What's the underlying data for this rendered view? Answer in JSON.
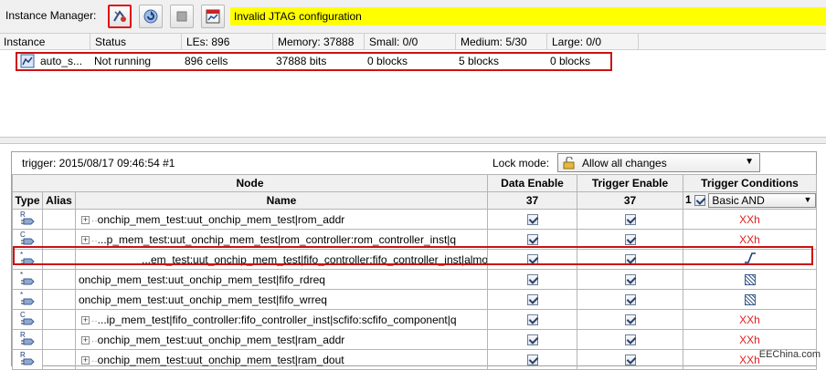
{
  "toolbar": {
    "label": "Instance Manager:",
    "status_message": "Invalid JTAG configuration",
    "status_bg": "#ffff00",
    "buttons": [
      {
        "name": "autorun-analysis-icon"
      },
      {
        "name": "run-analysis-icon"
      },
      {
        "name": "stop-analysis-icon"
      },
      {
        "name": "read-data-icon"
      }
    ]
  },
  "instance_table": {
    "headers": {
      "instance": "Instance",
      "status": "Status",
      "les": "LEs: 896",
      "memory": "Memory: 37888",
      "small": "Small: 0/0",
      "medium": "Medium: 5/30",
      "large": "Large: 0/0"
    },
    "row": {
      "instance": "auto_s...",
      "status": "Not running",
      "les": "896 cells",
      "memory": "37888 bits",
      "small": "0 blocks",
      "medium": "5 blocks",
      "large": "0 blocks"
    }
  },
  "trigger_panel": {
    "trigger_info": "trigger: 2015/08/17 09:46:54  #1",
    "lock_mode_label": "Lock mode:",
    "lock_mode_value": "Allow all changes",
    "headers": {
      "node": "Node",
      "data_enable": "Data Enable",
      "trigger_enable": "Trigger Enable",
      "trigger_conditions": "Trigger Conditions",
      "type": "Type",
      "alias": "Alias",
      "name": "Name",
      "data_enable_count": "37",
      "trigger_enable_count": "37",
      "trigger_cond_index": "1",
      "trigger_cond_mode": "Basic AND"
    },
    "rows": [
      {
        "type_letter": "R",
        "expandable": true,
        "name": "onchip_mem_test:uut_onchip_mem_test|rom_addr",
        "condition": "XXh"
      },
      {
        "type_letter": "C",
        "expandable": true,
        "name": "...p_mem_test:uut_onchip_mem_test|rom_controller:rom_controller_inst|q",
        "condition": "XXh"
      },
      {
        "type_letter": "*",
        "expandable": false,
        "name": "...em_test:uut_onchip_mem_test|fifo_controller:fifo_controller_inst|almost_full",
        "condition": "rising-edge"
      },
      {
        "type_letter": "*",
        "expandable": false,
        "name": "onchip_mem_test:uut_onchip_mem_test|fifo_rdreq",
        "condition": "either-edge"
      },
      {
        "type_letter": "*",
        "expandable": false,
        "name": "onchip_mem_test:uut_onchip_mem_test|fifo_wrreq",
        "condition": "either-edge"
      },
      {
        "type_letter": "C",
        "expandable": true,
        "name": "...ip_mem_test|fifo_controller:fifo_controller_inst|scfifo:scfifo_component|q",
        "condition": "XXh"
      },
      {
        "type_letter": "R",
        "expandable": true,
        "name": "onchip_mem_test:uut_onchip_mem_test|ram_addr",
        "condition": "XXh"
      },
      {
        "type_letter": "R",
        "expandable": true,
        "name": "onchip_mem_test:uut_onchip_mem_test|ram_dout",
        "condition": "XXh"
      }
    ]
  },
  "watermark": "EEChina.com",
  "colors": {
    "highlight_border": "#cc1111",
    "condition_text": "#e02020"
  }
}
